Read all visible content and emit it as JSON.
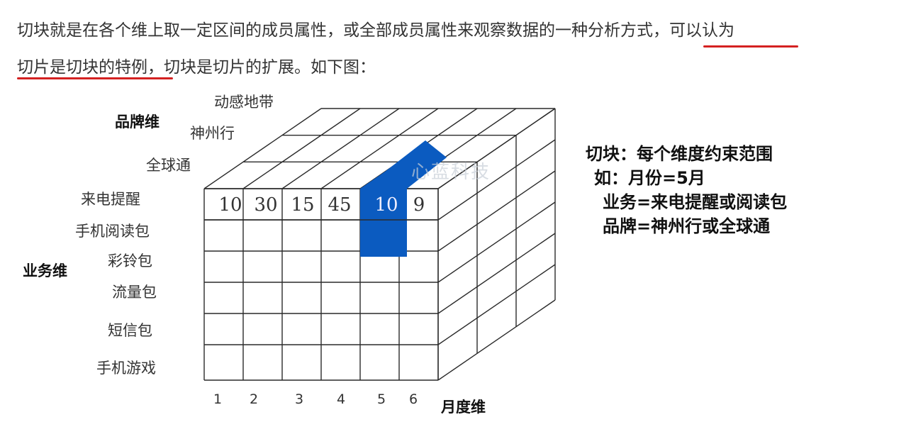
{
  "intro": {
    "line1": "切块就是在各个维上取一定区间的成员属性，或全部成员属性来观察数据的一种分析方式，可以认为",
    "line2": "切片是切块的特例，切块是切片的扩展。如下图："
  },
  "colors": {
    "underline": "#d42121",
    "highlight": "#0b5bc0",
    "grid": "#2a2a2a"
  },
  "diagram": {
    "brand_axis_title": "品牌维",
    "brands": [
      "动感地带",
      "神州行",
      "全球通"
    ],
    "business_axis_title": "业务维",
    "businesses": [
      "来电提醒",
      "手机阅读包",
      "彩铃包",
      "流量包",
      "短信包",
      "手机游戏"
    ],
    "month_axis_title": "月度维",
    "months": [
      "1",
      "2",
      "3",
      "4",
      "5",
      "6"
    ],
    "front_row_values": [
      "10",
      "30",
      "15",
      "45",
      "10",
      "9"
    ],
    "watermark": "心蓝科技"
  },
  "legend": {
    "title": "切块：每个维度约束范围",
    "line1": "如：月份=5月",
    "line2": "业务=来电提醒或阅读包",
    "line3": "品牌=神州行或全球通"
  }
}
